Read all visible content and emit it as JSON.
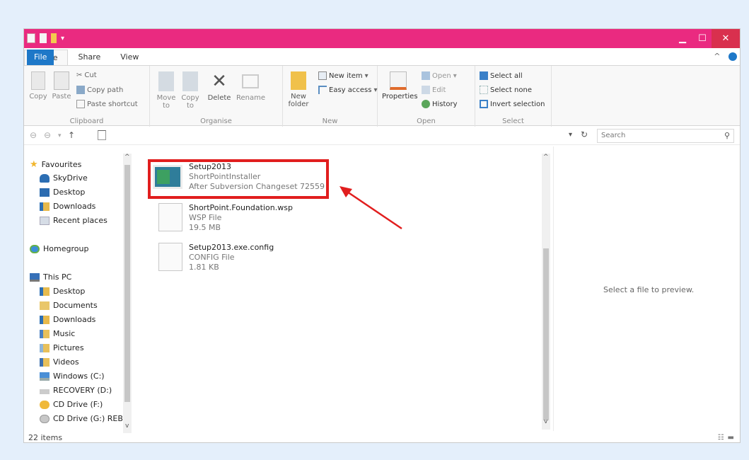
{
  "ribbon_tabs": [
    "File",
    "Home",
    "Share",
    "View"
  ],
  "clipboard": {
    "copy": "Copy",
    "paste": "Paste",
    "cut": "Cut",
    "copy_path": "Copy path",
    "paste_shortcut": "Paste shortcut",
    "label": "Clipboard"
  },
  "organise": {
    "move_to": "Move to",
    "copy_to": "Copy to",
    "delete": "Delete",
    "rename": "Rename",
    "label": "Organise"
  },
  "new_group": {
    "new_folder": "New folder",
    "new_item": "New item",
    "easy_access": "Easy access",
    "label": "New"
  },
  "open_group": {
    "properties": "Properties",
    "open": "Open",
    "edit": "Edit",
    "history": "History",
    "label": "Open"
  },
  "select_group": {
    "select_all": "Select all",
    "select_none": "Select none",
    "invert_selection": "Invert selection",
    "label": "Select"
  },
  "search": {
    "placeholder": "Search"
  },
  "nav": {
    "favourites": "Favourites",
    "skydrive": "SkyDrive",
    "desktop": "Desktop",
    "downloads": "Downloads",
    "recent_places": "Recent places",
    "homegroup": "Homegroup",
    "this_pc": "This PC",
    "pc_desktop": "Desktop",
    "documents": "Documents",
    "pc_downloads": "Downloads",
    "music": "Music",
    "pictures": "Pictures",
    "videos": "Videos",
    "windows_c": "Windows (C:)",
    "recovery_d": "RECOVERY (D:)",
    "cd_f": "CD Drive (F:)",
    "cd_g": "CD Drive (G:) REBS"
  },
  "files": [
    {
      "name": "Setup2013",
      "line2": "ShortPointInstaller",
      "line3": "After Subversion Changeset 72559"
    },
    {
      "name": "ShortPoint.Foundation.wsp",
      "line2": "WSP File",
      "line3": "19.5 MB"
    },
    {
      "name": "Setup2013.exe.config",
      "line2": "CONFIG File",
      "line3": "1.81 KB"
    }
  ],
  "preview_text": "Select a file to preview.",
  "status": "22 items",
  "colors": {
    "titlebar": "#ea2a80",
    "file_tab": "#1e78c8",
    "highlight": "#e11e1e",
    "background": "#e4effb"
  }
}
